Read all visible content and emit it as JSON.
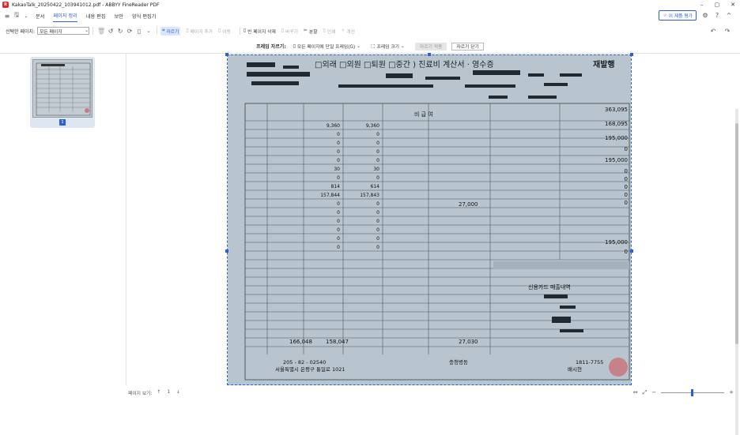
{
  "window": {
    "title": "KakaoTalk_20250422_103941012.pdf - ABBYY FineReader PDF",
    "app_icon_letter": "R",
    "controls": [
      "–",
      "▢",
      "✕"
    ]
  },
  "menu": {
    "items": [
      {
        "label": "문서",
        "active": false
      },
      {
        "label": "페이지 정리",
        "active": true
      },
      {
        "label": "내용 편집",
        "active": false
      },
      {
        "label": "보안",
        "active": false
      },
      {
        "label": "양식 편집기",
        "active": false
      }
    ],
    "trial_button": "이 제품 평가"
  },
  "toolbar": {
    "selected_pages_label": "선택한 페이지:",
    "selected_pages_value": "모든 페이지",
    "crop_label": "자르기",
    "add_page_label": "페이지 추가",
    "move_label": "이동",
    "blank_page_delete_label": "빈 페이지 삭제",
    "replace_label": "바꾸기",
    "split_label": "분할",
    "print_label": "인쇄",
    "improve_label": "개선"
  },
  "cropbar": {
    "frame_crop_label": "프레임 자르기:",
    "all_pages_same_frame": "모든 페이지에 단일 프레임(G)",
    "frame_size": "프레임 크기",
    "apply_crop": "자르기 적용",
    "close_crop": "자르기 닫기"
  },
  "sidebar": {
    "page_number": "1"
  },
  "statusbar": {
    "page_view_label": "페이지 보기:",
    "current_page": "1"
  },
  "document": {
    "header_text": "□외래 □외원 □퇴원 □중간 ) 진료비 계산서 · 영수증",
    "header_right": "재발행",
    "amounts": [
      "363,095",
      "168,095",
      "195,000",
      "0",
      "195,000",
      "0",
      "0",
      "0",
      "0",
      "0",
      "195,000",
      "0"
    ],
    "row_values_col1": [
      "9,360",
      "0",
      "0",
      "0",
      "0",
      "30",
      "0",
      "814",
      "157,844",
      "0",
      "0",
      "0",
      "0",
      "0",
      "0"
    ],
    "row_values_col2": [
      "9,360",
      "0",
      "0",
      "0",
      "0",
      "30",
      "0",
      "614",
      "157,843",
      "0",
      "0",
      "0",
      "0",
      "0",
      "0"
    ],
    "total_row": [
      "166,048",
      "158,047",
      "27,030"
    ],
    "bottom_reg": "205 - 82 - 02540",
    "bottom_addr": "서울특별시 은평구 통일로 1021",
    "bottom_code": "충청병동",
    "bottom_name": "배시현",
    "bottom_phone": "1811-7755",
    "card_title": "신용카드 매출내역",
    "amount_label_27": "27,000"
  },
  "colors": {
    "accent": "#2b5fd9",
    "doc_bg": "#b9c6cf"
  }
}
